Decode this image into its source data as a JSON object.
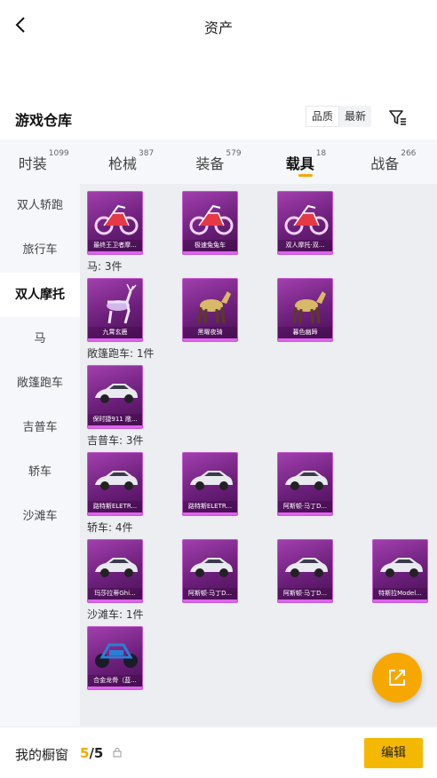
{
  "header": {
    "title": "资产"
  },
  "warehouse": {
    "title": "游戏仓库",
    "sort_options": [
      "品质",
      "最新"
    ]
  },
  "tabs": [
    {
      "label": "时装",
      "count": "1099"
    },
    {
      "label": "枪械",
      "count": "387"
    },
    {
      "label": "装备",
      "count": "579"
    },
    {
      "label": "载具",
      "count": "18"
    },
    {
      "label": "战备",
      "count": "266"
    }
  ],
  "sidebar": {
    "items": [
      "双人轿跑",
      "旅行车",
      "双人摩托",
      "马",
      "敞篷跑车",
      "吉普车",
      "轿车",
      "沙滩车"
    ]
  },
  "groups": [
    {
      "label": "",
      "items": [
        {
          "name": "最终王卫者摩...",
          "icon": "motorcycle"
        },
        {
          "name": "极速兔兔车",
          "icon": "motorcycle"
        },
        {
          "name": "双人摩托·双...",
          "icon": "motorcycle"
        }
      ]
    },
    {
      "label": "马: 3件",
      "items": [
        {
          "name": "九霄玄鹿",
          "icon": "deer"
        },
        {
          "name": "黑曜夜骑",
          "icon": "horse"
        },
        {
          "name": "暮色幽蹄",
          "icon": "horse"
        }
      ]
    },
    {
      "label": "敞篷跑车: 1件",
      "items": [
        {
          "name": "保时捷911 敞...",
          "icon": "car"
        }
      ]
    },
    {
      "label": "吉普车: 3件",
      "items": [
        {
          "name": "路特斯ELETR...",
          "icon": "car"
        },
        {
          "name": "路特斯ELETR...",
          "icon": "car"
        },
        {
          "name": "阿斯顿·马丁D...",
          "icon": "car"
        }
      ]
    },
    {
      "label": "轿车: 4件",
      "items": [
        {
          "name": "玛莎拉蒂Ghi...",
          "icon": "car"
        },
        {
          "name": "阿斯顿·马丁D...",
          "icon": "car"
        },
        {
          "name": "阿斯顿·马丁D...",
          "icon": "car"
        },
        {
          "name": "特斯拉Model...",
          "icon": "car"
        }
      ]
    },
    {
      "label": "沙滩车: 1件",
      "items": [
        {
          "name": "合金龙骨（蓝...",
          "icon": "buggy"
        }
      ]
    }
  ],
  "bottom": {
    "label": "我的橱窗",
    "count_current": "5",
    "count_total": "/5",
    "edit_label": "编辑"
  },
  "colors": {
    "accent": "#f5a800",
    "card_bg": "#7a2a8a"
  }
}
